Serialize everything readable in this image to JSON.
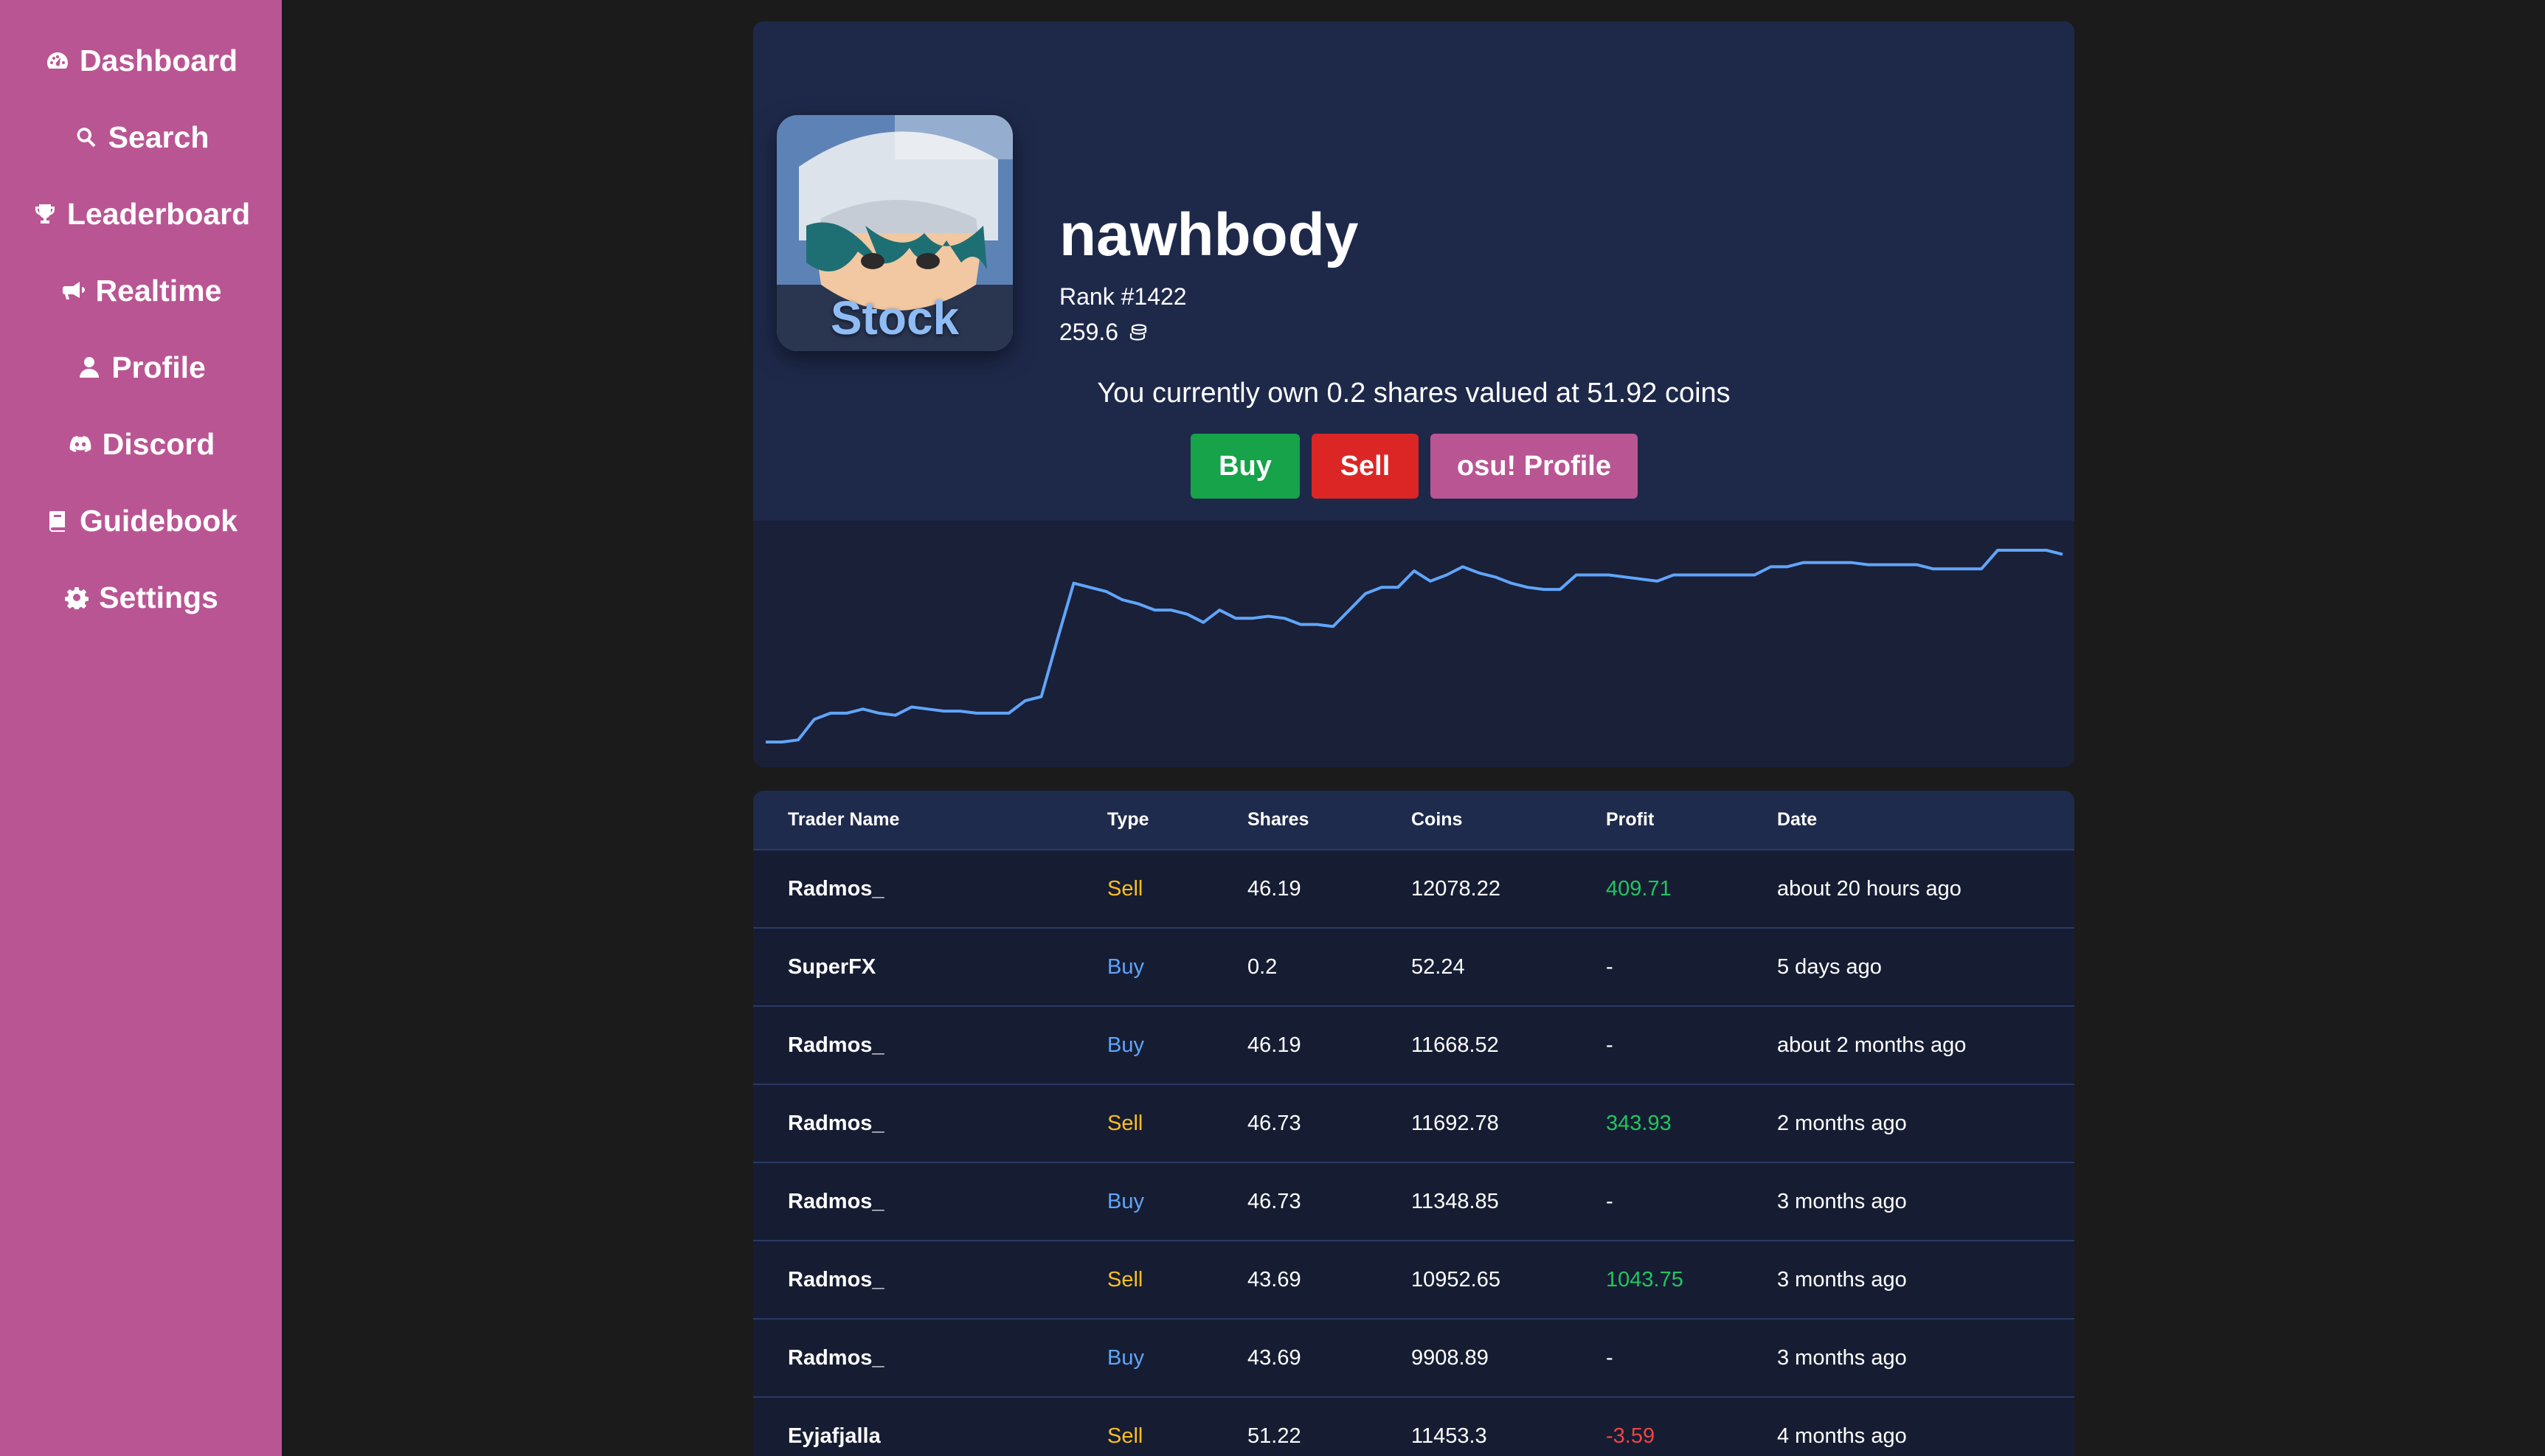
{
  "nav": {
    "items": [
      {
        "label": "Dashboard",
        "icon": "gauge-icon"
      },
      {
        "label": "Search",
        "icon": "search-icon"
      },
      {
        "label": "Leaderboard",
        "icon": "trophy-icon"
      },
      {
        "label": "Realtime",
        "icon": "megaphone-icon"
      },
      {
        "label": "Profile",
        "icon": "user-icon"
      },
      {
        "label": "Discord",
        "icon": "discord-icon"
      },
      {
        "label": "Guidebook",
        "icon": "book-icon"
      },
      {
        "label": "Settings",
        "icon": "gear-icon"
      }
    ]
  },
  "stock": {
    "avatar_label": "Stock",
    "username": "nawhbody",
    "rank": "Rank #1422",
    "price": "259.6",
    "ownership": "You currently own 0.2 shares valued at 51.92 coins",
    "buy_label": "Buy",
    "sell_label": "Sell",
    "osu_label": "osu! Profile"
  },
  "chart_data": {
    "type": "line",
    "title": "",
    "xlabel": "",
    "ylabel": "",
    "grid": false,
    "legend": "none",
    "color": "#60a5fa",
    "series": [
      {
        "values": [
          100,
          100,
          101,
          111,
          114,
          114,
          116,
          114,
          113,
          117,
          116,
          115,
          115,
          114,
          114,
          114,
          120,
          122,
          150,
          177,
          175,
          173,
          169,
          167,
          164,
          164,
          162,
          158,
          164,
          160,
          160,
          161,
          160,
          157,
          157,
          156,
          164,
          172,
          175,
          175,
          183,
          178,
          181,
          185,
          182,
          180,
          177,
          175,
          174,
          174,
          181,
          181,
          181,
          180,
          179,
          178,
          181,
          181,
          181,
          181,
          181,
          181,
          185,
          185,
          187,
          187,
          187,
          187,
          186,
          186,
          186,
          186,
          184,
          184,
          184,
          184,
          193,
          193,
          193,
          193,
          191
        ]
      }
    ]
  },
  "table": {
    "headers": [
      "Trader Name",
      "Type",
      "Shares",
      "Coins",
      "Profit",
      "Date"
    ],
    "rows": [
      {
        "name": "Radmos_",
        "type": "Sell",
        "shares": "46.19",
        "coins": "12078.22",
        "profit": "409.71",
        "profit_kind": "pos",
        "date": "about 20 hours ago"
      },
      {
        "name": "SuperFX",
        "type": "Buy",
        "shares": "0.2",
        "coins": "52.24",
        "profit": "-",
        "profit_kind": "none",
        "date": "5 days ago"
      },
      {
        "name": "Radmos_",
        "type": "Buy",
        "shares": "46.19",
        "coins": "11668.52",
        "profit": "-",
        "profit_kind": "none",
        "date": "about 2 months ago"
      },
      {
        "name": "Radmos_",
        "type": "Sell",
        "shares": "46.73",
        "coins": "11692.78",
        "profit": "343.93",
        "profit_kind": "pos",
        "date": "2 months ago"
      },
      {
        "name": "Radmos_",
        "type": "Buy",
        "shares": "46.73",
        "coins": "11348.85",
        "profit": "-",
        "profit_kind": "none",
        "date": "3 months ago"
      },
      {
        "name": "Radmos_",
        "type": "Sell",
        "shares": "43.69",
        "coins": "10952.65",
        "profit": "1043.75",
        "profit_kind": "pos",
        "date": "3 months ago"
      },
      {
        "name": "Radmos_",
        "type": "Buy",
        "shares": "43.69",
        "coins": "9908.89",
        "profit": "-",
        "profit_kind": "none",
        "date": "3 months ago"
      },
      {
        "name": "Eyjafjalla",
        "type": "Sell",
        "shares": "51.22",
        "coins": "11453.3",
        "profit": "-3.59",
        "profit_kind": "neg",
        "date": "4 months ago"
      }
    ]
  }
}
